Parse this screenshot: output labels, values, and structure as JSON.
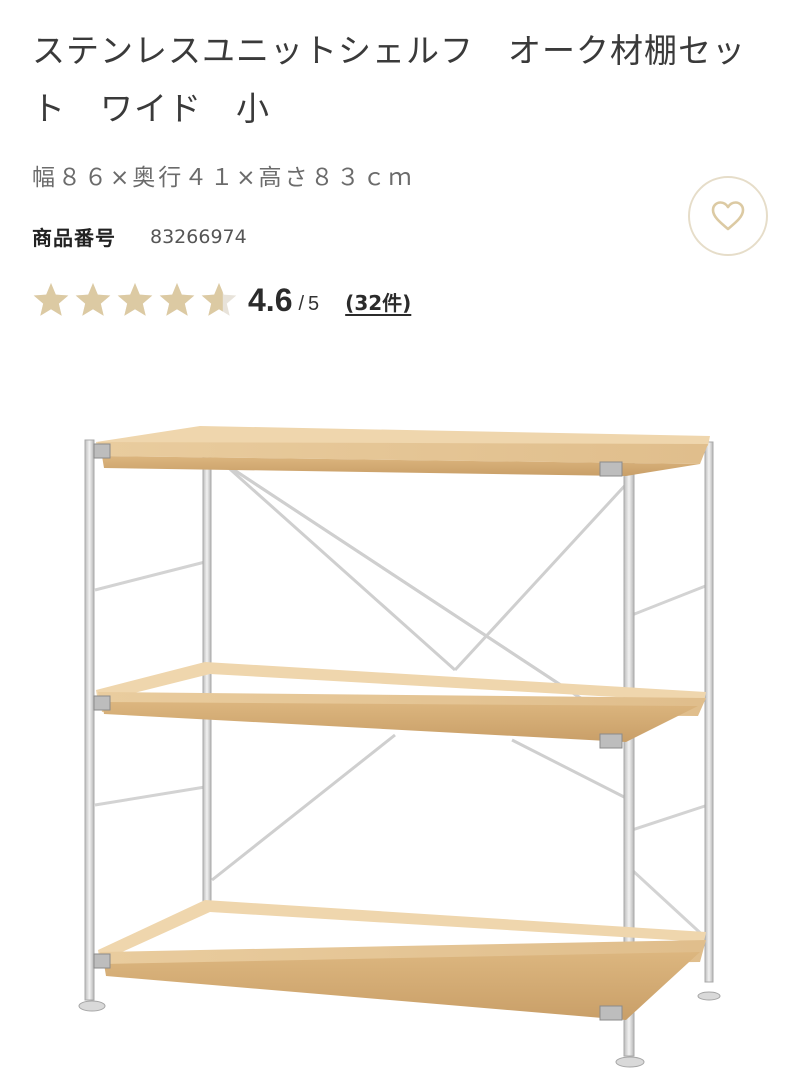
{
  "product": {
    "title": "ステンレスユニットシェルフ　オーク材棚セット　ワイド　小",
    "specs": "幅８６×奥行４１×高さ８３ｃｍ",
    "number_label": "商品番号",
    "number_value": "83266974"
  },
  "rating": {
    "score": "4.6",
    "slash": "/",
    "max": "5",
    "stars_value": 4.6,
    "reviews": "(32件)"
  },
  "icons": {
    "favorite": "heart-icon",
    "star": "star-icon"
  },
  "colors": {
    "star": "#dccaa3",
    "star_empty": "#e8e3da",
    "heart_border": "#e6ddc9",
    "wood": "#e3c292",
    "steel": "#d6d6d6"
  }
}
